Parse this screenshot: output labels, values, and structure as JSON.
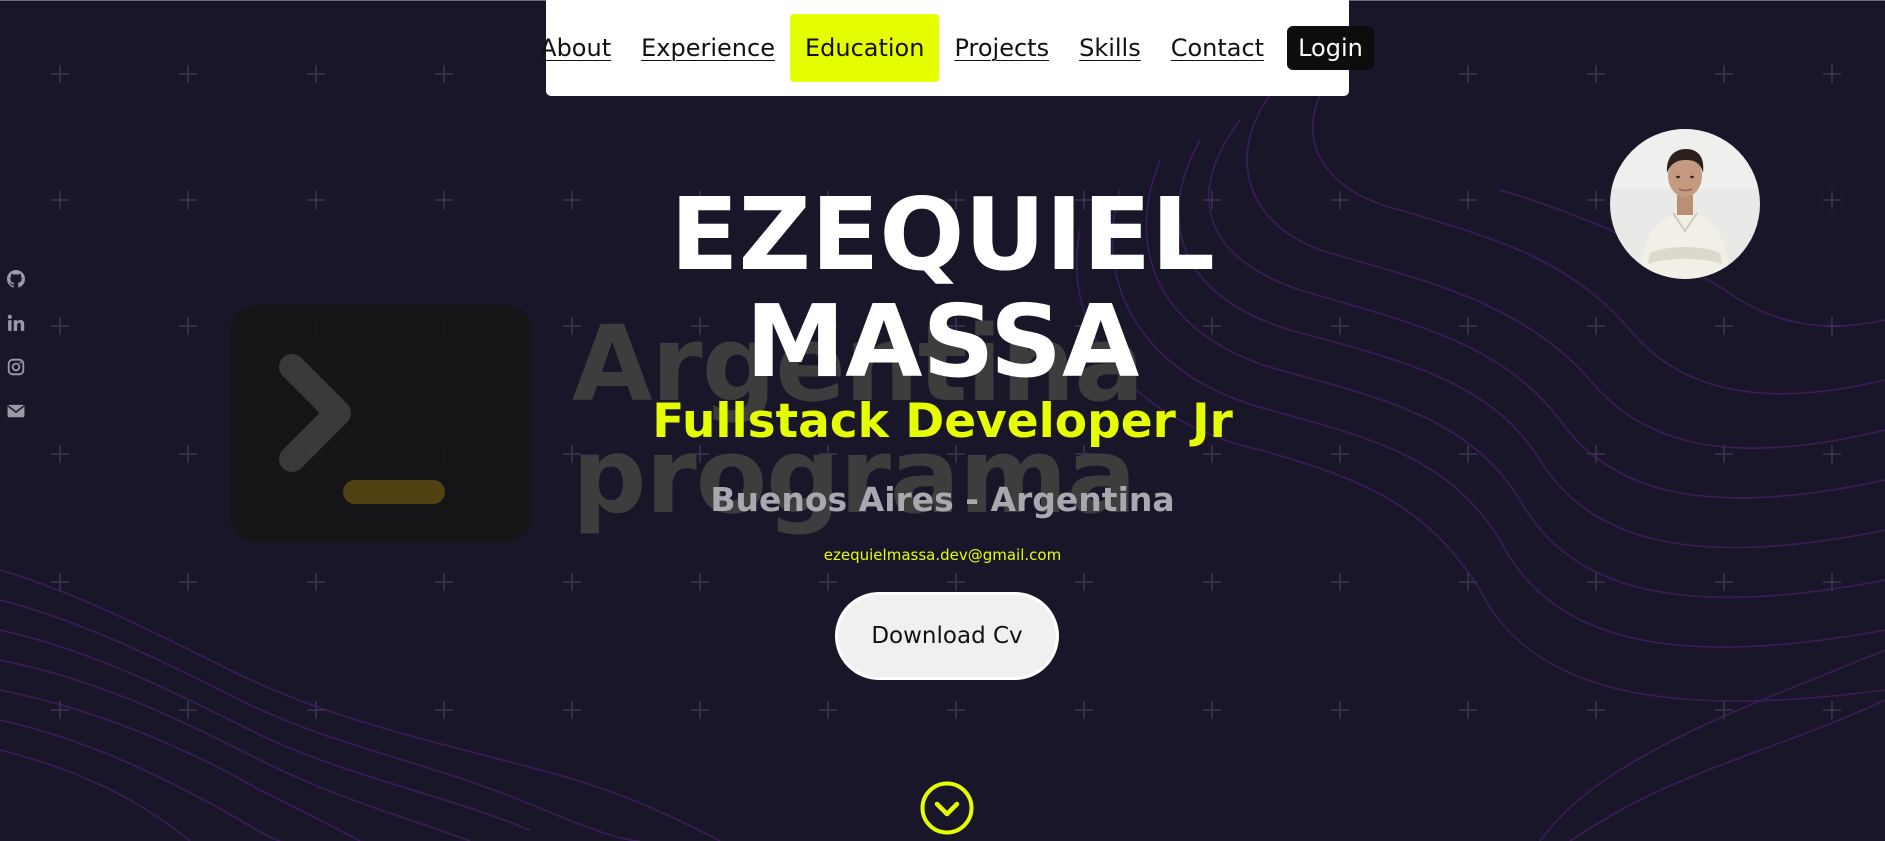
{
  "nav": {
    "links": [
      {
        "label": "About",
        "active": false
      },
      {
        "label": "Experience",
        "active": false
      },
      {
        "label": "Education",
        "active": true
      },
      {
        "label": "Projects",
        "active": false
      },
      {
        "label": "Skills",
        "active": false
      },
      {
        "label": "Contact",
        "active": false
      }
    ],
    "login_label": "Login"
  },
  "social": [
    "github-icon",
    "linkedin-icon",
    "instagram-icon",
    "mail-icon"
  ],
  "background": {
    "logo_line1": "Argentina",
    "logo_line2": "programa"
  },
  "hero": {
    "first_name": "EZEQUIEL",
    "last_name": "MASSA",
    "role": "Fullstack Developer Jr",
    "location": "Buenos Aires - Argentina",
    "email": "ezequielmassa.dev@gmail.com",
    "cv_button": "Download Cv"
  },
  "colors": {
    "accent": "#e6ff00",
    "background": "#19162a",
    "nav_background": "#ffffff",
    "login_background": "#0d0d0d"
  },
  "icons": {
    "scroll": "chevron-down-circle-icon",
    "avatar": "profile-photo"
  }
}
